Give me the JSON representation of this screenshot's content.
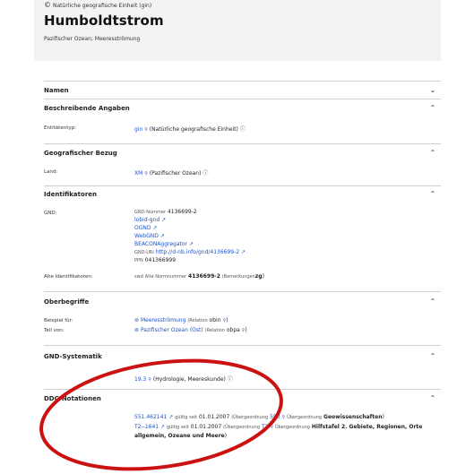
{
  "header": {
    "entity_type": "Natürliche geografische Einheit (gin)",
    "title": "Humboldtstrom",
    "subtitle": "Pazifischer Ozean; Meeresströmung"
  },
  "sections": {
    "namen": {
      "title": "Namen"
    },
    "beschreibende": {
      "title": "Beschreibende Angaben",
      "rows": [
        {
          "label": "Entitätentyp:",
          "code": "gin",
          "text": "(Natürliche geografische Einheit)"
        }
      ]
    },
    "geobezug": {
      "title": "Geografischer Bezug",
      "rows": [
        {
          "label": "Land:",
          "code": "XM",
          "text": "(Pazifischer Ozean)"
        }
      ]
    },
    "identifikatoren": {
      "title": "Identifikatoren",
      "gnd_label": "GND:",
      "gnd_nummer_label": "GND-Nummer",
      "gnd_nummer": "4136699-2",
      "links": [
        "lobid-gnd",
        "OGND",
        "WebGND",
        "BEACONAggregator"
      ],
      "uri_label": "GND-URI",
      "uri": "http://d-nb.info/gnd/4136699-2",
      "ppn_label": "PPN",
      "ppn": "041366999",
      "alte_label": "Alte Identifikatoren:",
      "alte_prefix": "swd",
      "alte_mid": "Alte Normnummer",
      "alte_number": "4136699-2",
      "alte_bem": "(Bemerkungen",
      "alte_zg": "zg",
      "alte_close": ")"
    },
    "oberbegriffe": {
      "title": "Oberbegriffe",
      "rows": [
        {
          "label": "Beispiel für:",
          "link": "Meeresströmung",
          "rel_label": "(Relation",
          "rel": "obin",
          "close": ")"
        },
        {
          "label": "Teil von:",
          "link": "Pazifischer Ozean (Ost)",
          "rel_label": "(Relation",
          "rel": "obpa",
          "close": ")"
        }
      ]
    },
    "systematik": {
      "title": "GND-Systematik",
      "code": "19.3",
      "text": "(Hydrologie, Meereskunde)"
    },
    "ddc": {
      "title": "DDC-Notationen",
      "rows": [
        {
          "code": "551.462141",
          "since_label": "gültig seit",
          "since": "01.01.2007",
          "ueb_label": "(Übergeordnung",
          "ueb_code": "550",
          "ueb2_label": "Übergeordnung",
          "ueb2": "Geowissenschaften",
          "close": ")"
        },
        {
          "code": "T2--1641",
          "since_label": "gültig seit",
          "since": "01.01.2007",
          "ueb_label": "(Übergeordnung",
          "ueb_code": "T2",
          "ueb2_label": "Übergeordnung",
          "ueb2": "Hilfstafel 2. Gebiete, Regionen, Orte allgemein, Ozeane und Meere",
          "close": ")"
        }
      ]
    }
  },
  "icons": {
    "collapse": "chevron-up-icon",
    "expand": "chevron-down-icon",
    "search": "magnifier-icon",
    "external": "external-link-icon",
    "info": "info-icon"
  },
  "colors": {
    "link": "#1f52c7",
    "annotation": "#cc1111",
    "header_bg": "#f3f3f3"
  }
}
